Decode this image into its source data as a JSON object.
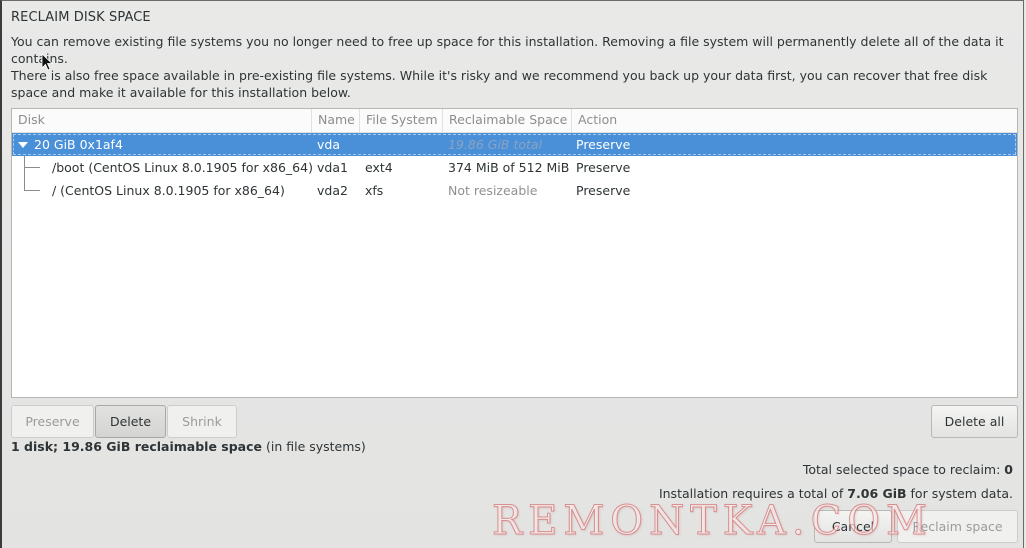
{
  "dialog": {
    "title": "RECLAIM DISK SPACE",
    "paragraph1": "You can remove existing file systems you no longer need to free up space for this installation.  Removing a file system will permanently delete all of the data it contains.",
    "paragraph2": "There is also free space available in pre-existing file systems.  While it's risky and we recommend you back up your data first, you can recover that free disk space and make it available for this installation below."
  },
  "table": {
    "columns": [
      "Disk",
      "Name",
      "File System",
      "Reclaimable Space",
      "Action"
    ],
    "rows": [
      {
        "disk": "20 GiB 0x1af4",
        "name": "vda",
        "filesystem": "",
        "reclaimable": "19.86 GiB total",
        "action": "Preserve",
        "selected": true,
        "expanded": true
      },
      {
        "disk": "/boot (CentOS Linux 8.0.1905 for x86_64)",
        "name": "vda1",
        "filesystem": "ext4",
        "reclaimable": "374 MiB of 512 MiB",
        "action": "Preserve"
      },
      {
        "disk": "/ (CentOS Linux 8.0.1905 for x86_64)",
        "name": "vda2",
        "filesystem": "xfs",
        "reclaimable": "Not resizeable",
        "action": "Preserve"
      }
    ]
  },
  "buttons": {
    "preserve": "Preserve",
    "delete": "Delete",
    "shrink": "Shrink",
    "delete_all": "Delete all",
    "cancel": "Cancel",
    "reclaim": "Reclaim space"
  },
  "summary": {
    "bold": "1 disk; 19.86 GiB reclaimable space",
    "rest": " (in file systems)"
  },
  "totals": {
    "selected_label": "Total selected space to reclaim: ",
    "selected_value": "0",
    "requires_prefix": "Installation requires a total of ",
    "requires_value": "7.06 GiB",
    "requires_suffix": " for system data."
  },
  "watermark": "REMONTKA.COM"
}
